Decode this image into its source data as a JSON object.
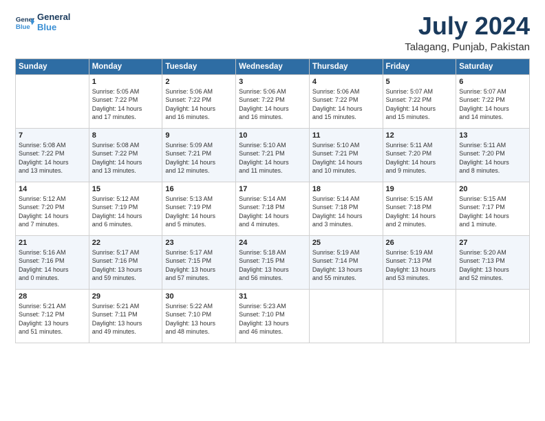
{
  "header": {
    "logo_line1": "General",
    "logo_line2": "Blue",
    "title": "July 2024",
    "subtitle": "Talagang, Punjab, Pakistan"
  },
  "days_of_week": [
    "Sunday",
    "Monday",
    "Tuesday",
    "Wednesday",
    "Thursday",
    "Friday",
    "Saturday"
  ],
  "weeks": [
    [
      {
        "day": "",
        "text": ""
      },
      {
        "day": "1",
        "text": "Sunrise: 5:05 AM\nSunset: 7:22 PM\nDaylight: 14 hours\nand 17 minutes."
      },
      {
        "day": "2",
        "text": "Sunrise: 5:06 AM\nSunset: 7:22 PM\nDaylight: 14 hours\nand 16 minutes."
      },
      {
        "day": "3",
        "text": "Sunrise: 5:06 AM\nSunset: 7:22 PM\nDaylight: 14 hours\nand 16 minutes."
      },
      {
        "day": "4",
        "text": "Sunrise: 5:06 AM\nSunset: 7:22 PM\nDaylight: 14 hours\nand 15 minutes."
      },
      {
        "day": "5",
        "text": "Sunrise: 5:07 AM\nSunset: 7:22 PM\nDaylight: 14 hours\nand 15 minutes."
      },
      {
        "day": "6",
        "text": "Sunrise: 5:07 AM\nSunset: 7:22 PM\nDaylight: 14 hours\nand 14 minutes."
      }
    ],
    [
      {
        "day": "7",
        "text": "Sunrise: 5:08 AM\nSunset: 7:22 PM\nDaylight: 14 hours\nand 13 minutes."
      },
      {
        "day": "8",
        "text": "Sunrise: 5:08 AM\nSunset: 7:22 PM\nDaylight: 14 hours\nand 13 minutes."
      },
      {
        "day": "9",
        "text": "Sunrise: 5:09 AM\nSunset: 7:21 PM\nDaylight: 14 hours\nand 12 minutes."
      },
      {
        "day": "10",
        "text": "Sunrise: 5:10 AM\nSunset: 7:21 PM\nDaylight: 14 hours\nand 11 minutes."
      },
      {
        "day": "11",
        "text": "Sunrise: 5:10 AM\nSunset: 7:21 PM\nDaylight: 14 hours\nand 10 minutes."
      },
      {
        "day": "12",
        "text": "Sunrise: 5:11 AM\nSunset: 7:20 PM\nDaylight: 14 hours\nand 9 minutes."
      },
      {
        "day": "13",
        "text": "Sunrise: 5:11 AM\nSunset: 7:20 PM\nDaylight: 14 hours\nand 8 minutes."
      }
    ],
    [
      {
        "day": "14",
        "text": "Sunrise: 5:12 AM\nSunset: 7:20 PM\nDaylight: 14 hours\nand 7 minutes."
      },
      {
        "day": "15",
        "text": "Sunrise: 5:12 AM\nSunset: 7:19 PM\nDaylight: 14 hours\nand 6 minutes."
      },
      {
        "day": "16",
        "text": "Sunrise: 5:13 AM\nSunset: 7:19 PM\nDaylight: 14 hours\nand 5 minutes."
      },
      {
        "day": "17",
        "text": "Sunrise: 5:14 AM\nSunset: 7:18 PM\nDaylight: 14 hours\nand 4 minutes."
      },
      {
        "day": "18",
        "text": "Sunrise: 5:14 AM\nSunset: 7:18 PM\nDaylight: 14 hours\nand 3 minutes."
      },
      {
        "day": "19",
        "text": "Sunrise: 5:15 AM\nSunset: 7:18 PM\nDaylight: 14 hours\nand 2 minutes."
      },
      {
        "day": "20",
        "text": "Sunrise: 5:15 AM\nSunset: 7:17 PM\nDaylight: 14 hours\nand 1 minute."
      }
    ],
    [
      {
        "day": "21",
        "text": "Sunrise: 5:16 AM\nSunset: 7:16 PM\nDaylight: 14 hours\nand 0 minutes."
      },
      {
        "day": "22",
        "text": "Sunrise: 5:17 AM\nSunset: 7:16 PM\nDaylight: 13 hours\nand 59 minutes."
      },
      {
        "day": "23",
        "text": "Sunrise: 5:17 AM\nSunset: 7:15 PM\nDaylight: 13 hours\nand 57 minutes."
      },
      {
        "day": "24",
        "text": "Sunrise: 5:18 AM\nSunset: 7:15 PM\nDaylight: 13 hours\nand 56 minutes."
      },
      {
        "day": "25",
        "text": "Sunrise: 5:19 AM\nSunset: 7:14 PM\nDaylight: 13 hours\nand 55 minutes."
      },
      {
        "day": "26",
        "text": "Sunrise: 5:19 AM\nSunset: 7:13 PM\nDaylight: 13 hours\nand 53 minutes."
      },
      {
        "day": "27",
        "text": "Sunrise: 5:20 AM\nSunset: 7:13 PM\nDaylight: 13 hours\nand 52 minutes."
      }
    ],
    [
      {
        "day": "28",
        "text": "Sunrise: 5:21 AM\nSunset: 7:12 PM\nDaylight: 13 hours\nand 51 minutes."
      },
      {
        "day": "29",
        "text": "Sunrise: 5:21 AM\nSunset: 7:11 PM\nDaylight: 13 hours\nand 49 minutes."
      },
      {
        "day": "30",
        "text": "Sunrise: 5:22 AM\nSunset: 7:10 PM\nDaylight: 13 hours\nand 48 minutes."
      },
      {
        "day": "31",
        "text": "Sunrise: 5:23 AM\nSunset: 7:10 PM\nDaylight: 13 hours\nand 46 minutes."
      },
      {
        "day": "",
        "text": ""
      },
      {
        "day": "",
        "text": ""
      },
      {
        "day": "",
        "text": ""
      }
    ]
  ]
}
